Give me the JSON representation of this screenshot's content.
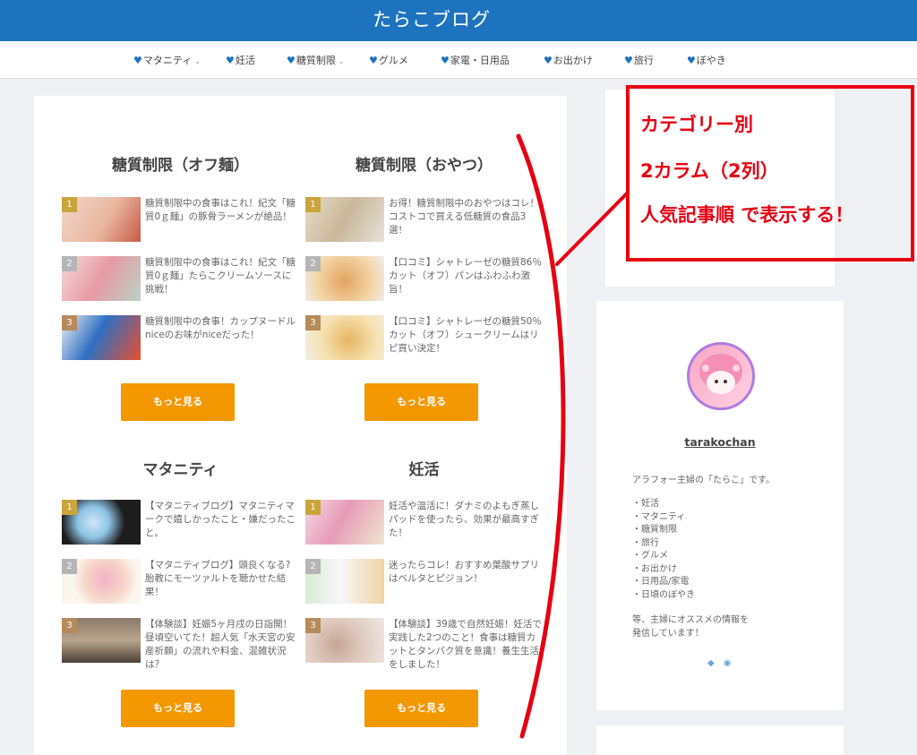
{
  "site": {
    "title": "たらこブログ"
  },
  "nav": [
    {
      "label": "マタニティ",
      "has_dropdown": true
    },
    {
      "label": "妊活",
      "has_dropdown": false
    },
    {
      "label": "糖質制限",
      "has_dropdown": true
    },
    {
      "label": "グルメ",
      "has_dropdown": false
    },
    {
      "label": "家電・日用品",
      "has_dropdown": false
    },
    {
      "label": "お出かけ",
      "has_dropdown": false
    },
    {
      "label": "旅行",
      "has_dropdown": false
    },
    {
      "label": "ぼやき",
      "has_dropdown": false
    }
  ],
  "nav_icon": "heart-icon",
  "categories": [
    {
      "title": "糖質制限（オフ麺）",
      "items": [
        {
          "rank": "1",
          "text": "糖質制限中の食事はこれ！紀文「糖質0ｇ麺」の豚骨ラーメンが絶品！"
        },
        {
          "rank": "2",
          "text": "糖質制限中の食事はこれ！紀文「糖質0ｇ麺」たらこクリームソースに挑戦！"
        },
        {
          "rank": "3",
          "text": "糖質制限中の食事！カップヌードルniceのお味がniceだった！"
        }
      ],
      "more": "もっと見る"
    },
    {
      "title": "糖質制限（おやつ）",
      "items": [
        {
          "rank": "1",
          "text": "お得！糖質制限中のおやつはコレ！コストコで買える低糖質の食品3選！"
        },
        {
          "rank": "2",
          "text": "【口コミ】シャトレーゼの糖質86％カット（オフ）パンはふわふわ激旨！"
        },
        {
          "rank": "3",
          "text": "【口コミ】シャトレーゼの糖質50％カット（オフ）シュークリームはリピ買い決定！"
        }
      ],
      "more": "もっと見る"
    },
    {
      "title": "マタニティ",
      "items": [
        {
          "rank": "1",
          "text": "【マタニティブログ】マタニティマークで嬉しかったこと・嫌だったこと。"
        },
        {
          "rank": "2",
          "text": "【マタニティブログ】頭良くなる?胎教にモーツァルトを聴かせた結果！"
        },
        {
          "rank": "3",
          "text": "【体験談】妊娠5ヶ月戌の日詣開！昼頃空いてた！超人気「水天宮の安産祈願」の流れや料金、混雑状況は？"
        }
      ],
      "more": "もっと見る"
    },
    {
      "title": "妊活",
      "items": [
        {
          "rank": "1",
          "text": "妊活や温活に！ダナミのよもぎ蒸しパッドを使ったら、効果が最高すぎた！"
        },
        {
          "rank": "2",
          "text": "迷ったらコレ！おすすめ葉酸サプリはベルタとピジョン！"
        },
        {
          "rank": "3",
          "text": "【体験談】39歳で自然妊娠！妊活で実践した2つのこと！食事は糖質カットとタンパク質を意識！養生生活をしました！"
        }
      ],
      "more": "もっと見る"
    }
  ],
  "profile": {
    "name": "tarakochan",
    "intro": "アラフォー主婦の「たらこ」です。",
    "topics": [
      "・妊活",
      "・マタニティ",
      "・糖質制限",
      "・旅行",
      "・グルメ",
      "・お出かけ",
      "・日用品/家電",
      "・日頃のぼやき"
    ],
    "note_lines": [
      "等、主婦にオススメの情報を",
      "発信しています！"
    ],
    "sns_icons": [
      "feedly-icon",
      "rss-icon"
    ]
  },
  "annotation": {
    "lines": [
      "カテゴリー別",
      "2カラム（2列）",
      "人気記事順 で表示する！"
    ],
    "color": "#e60012"
  },
  "colors": {
    "header": "#1e73be",
    "button": "#f39800",
    "background": "#eff0f4"
  }
}
